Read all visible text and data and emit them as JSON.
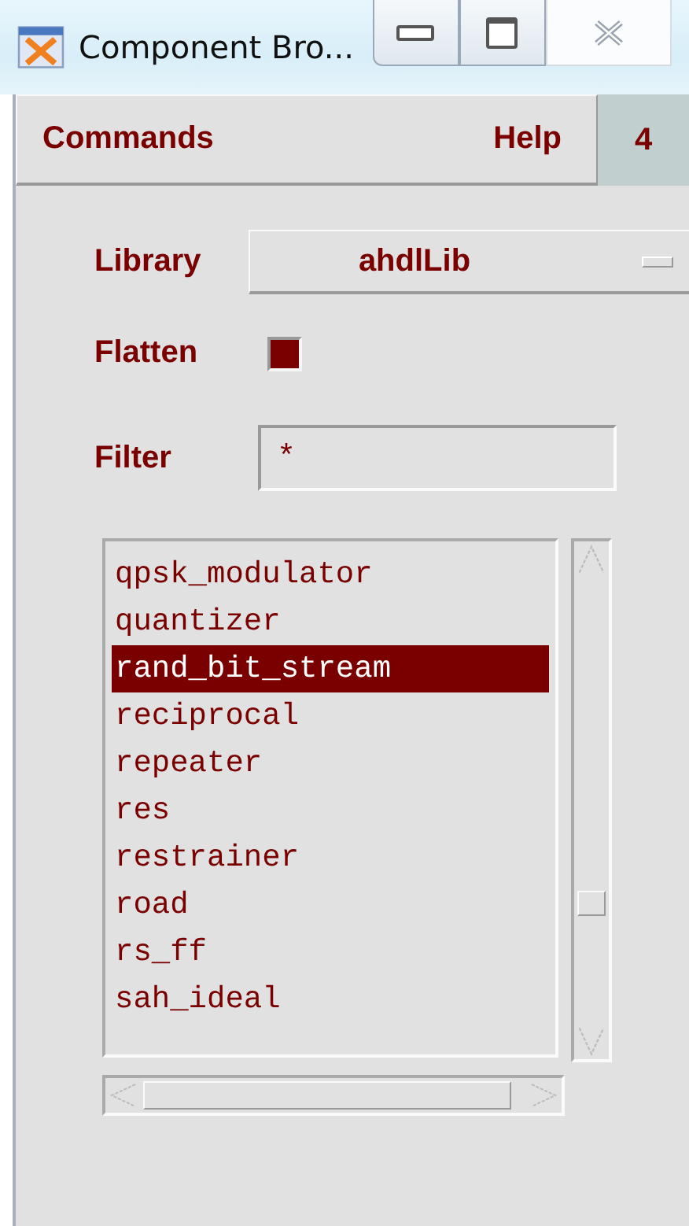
{
  "window": {
    "title": "Component Bro..."
  },
  "menu": [
    {
      "label": "Commands"
    },
    {
      "label": "Help"
    }
  ],
  "menu_badge": "4",
  "library": {
    "label": "Library",
    "value": "ahdlLib"
  },
  "flatten": {
    "label": "Flatten",
    "checked": true
  },
  "filter": {
    "label": "Filter",
    "value": "*"
  },
  "components": [
    {
      "name": "qpsk_modulator",
      "selected": false
    },
    {
      "name": "quantizer",
      "selected": false
    },
    {
      "name": "rand_bit_stream",
      "selected": true
    },
    {
      "name": "reciprocal",
      "selected": false
    },
    {
      "name": "repeater",
      "selected": false
    },
    {
      "name": "res",
      "selected": false
    },
    {
      "name": "restrainer",
      "selected": false
    },
    {
      "name": "road",
      "selected": false
    },
    {
      "name": "rs_ff",
      "selected": false
    },
    {
      "name": "sah_ideal",
      "selected": false
    }
  ]
}
